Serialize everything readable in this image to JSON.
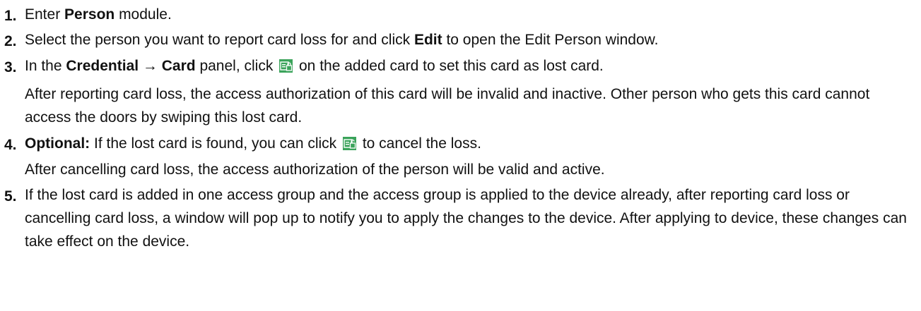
{
  "steps": [
    {
      "number": "1.",
      "pre": "Enter ",
      "bold": "Person",
      "post": " module."
    },
    {
      "number": "2.",
      "pre": "Select the person you want to report card loss for and click ",
      "bold": "Edit",
      "post": " to open the Edit Person window."
    },
    {
      "number": "3.",
      "pre": "In the ",
      "bold": "Credential → Card",
      "mid": " panel, click ",
      "icon": "report-card-loss-icon",
      "post": " on the added card to set this card as lost card.",
      "note": "After reporting card loss, the access authorization of this card will be invalid and inactive. Other person who gets this card cannot access the doors by swiping this lost card."
    },
    {
      "number": "4.",
      "bold": "Optional:",
      "mid": " If the lost card is found, you can click ",
      "icon": "cancel-card-loss-icon",
      "post": " to cancel the loss.",
      "note": "After cancelling card loss, the access authorization of the person will be valid and active."
    },
    {
      "number": "5.",
      "text": "If the lost card is added in one access group and the access group is applied to the device already, after reporting card loss or cancelling card loss, a window will pop up to notify you to apply the changes to the device. After applying to device, these changes can take effect on the device."
    }
  ],
  "colors": {
    "text": "#111111",
    "icon_green": "#3aa35a",
    "icon_gray": "#8a8a8a"
  }
}
